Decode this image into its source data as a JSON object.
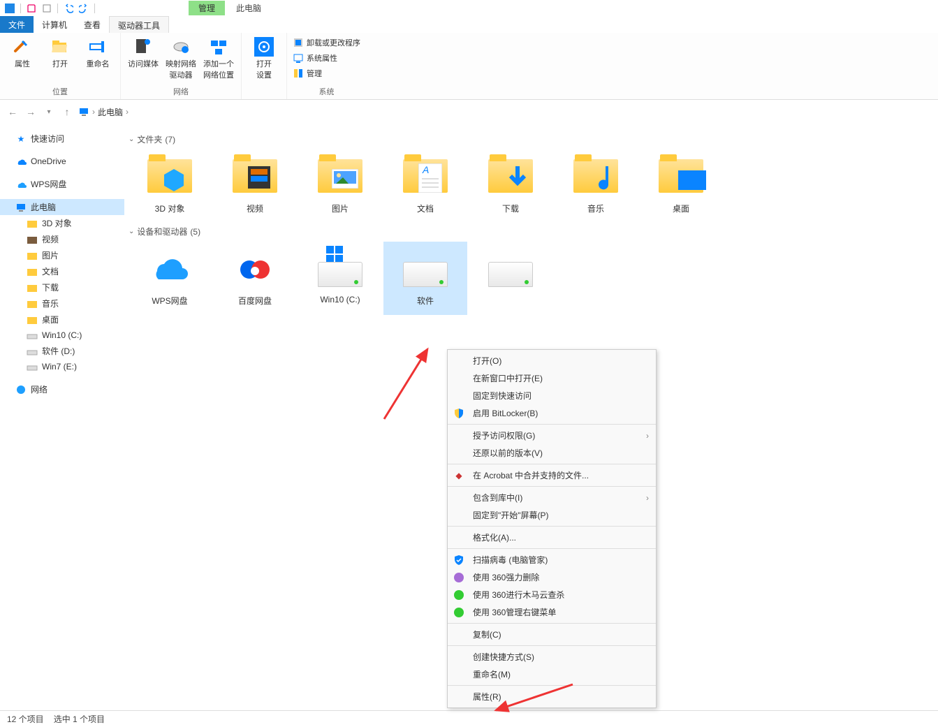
{
  "titlebar": {
    "context_tab": "管理",
    "location_title": "此电脑"
  },
  "tabs": {
    "file": "文件",
    "computer": "计算机",
    "view": "查看",
    "drive_tools": "驱动器工具"
  },
  "ribbon": {
    "group1": {
      "label": "位置",
      "properties": "属性",
      "open": "打开",
      "rename": "重命名"
    },
    "group2": {
      "label": "网络",
      "media": "访问媒体",
      "map_drive": "映射网络\n驱动器",
      "add_net": "添加一个\n网络位置"
    },
    "group3": {
      "label": "",
      "open_settings": "打开\n设置"
    },
    "group4": {
      "label": "系统",
      "uninstall": "卸载或更改程序",
      "sysprop": "系统属性",
      "manage": "管理"
    }
  },
  "breadcrumb": {
    "root": "此电脑",
    "sep": "›"
  },
  "sidebar": {
    "quick": "快速访问",
    "onedrive": "OneDrive",
    "wps": "WPS网盘",
    "thispc": "此电脑",
    "items": [
      "3D 对象",
      "视频",
      "图片",
      "文档",
      "下载",
      "音乐",
      "桌面",
      "Win10 (C:)",
      "软件 (D:)",
      "Win7 (E:)"
    ],
    "network": "网络"
  },
  "sections": {
    "folders": {
      "label": "文件夹",
      "count": "(7)"
    },
    "devices": {
      "label": "设备和驱动器",
      "count": "(5)"
    }
  },
  "folders": [
    "3D 对象",
    "视频",
    "图片",
    "文档",
    "下载",
    "音乐",
    "桌面"
  ],
  "drives": [
    "WPS网盘",
    "百度网盘",
    "Win10 (C:)",
    "软件",
    ""
  ],
  "context_menu": [
    {
      "label": "打开(O)"
    },
    {
      "label": "在新窗口中打开(E)"
    },
    {
      "label": "固定到快速访问"
    },
    {
      "label": "启用 BitLocker(B)",
      "icon": "shield"
    },
    {
      "sep": true
    },
    {
      "label": "授予访问权限(G)",
      "sub": true
    },
    {
      "label": "还原以前的版本(V)"
    },
    {
      "sep": true
    },
    {
      "label": "在 Acrobat 中合并支持的文件...",
      "icon": "acrobat"
    },
    {
      "sep": true
    },
    {
      "label": "包含到库中(I)",
      "sub": true
    },
    {
      "label": "固定到\"开始\"屏幕(P)"
    },
    {
      "sep": true
    },
    {
      "label": "格式化(A)..."
    },
    {
      "sep": true
    },
    {
      "label": "扫描病毒 (电脑管家)",
      "icon": "scan"
    },
    {
      "label": "使用 360强力删除",
      "icon": "360purple"
    },
    {
      "label": "使用 360进行木马云查杀",
      "icon": "360green"
    },
    {
      "label": "使用 360管理右键菜单",
      "icon": "360green"
    },
    {
      "sep": true
    },
    {
      "label": "复制(C)"
    },
    {
      "sep": true
    },
    {
      "label": "创建快捷方式(S)"
    },
    {
      "label": "重命名(M)"
    },
    {
      "sep": true
    },
    {
      "label": "属性(R)"
    }
  ],
  "status": {
    "count": "12 个项目",
    "selected": "选中 1 个项目"
  }
}
